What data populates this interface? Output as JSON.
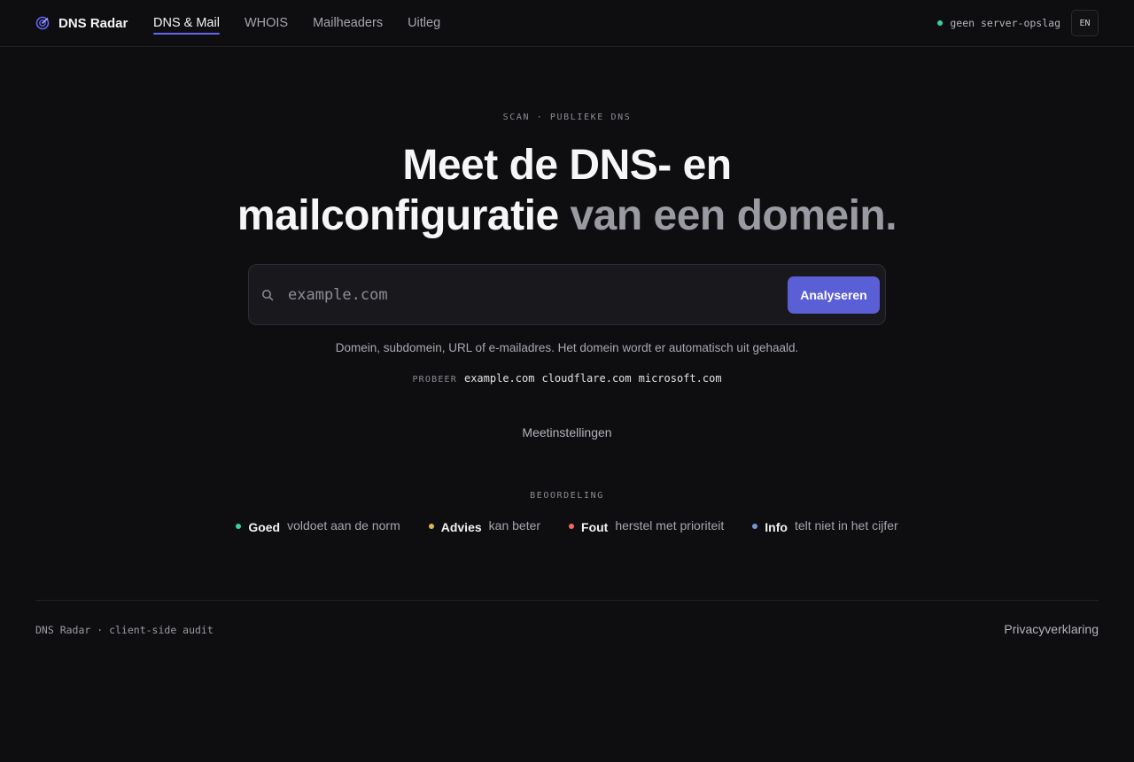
{
  "header": {
    "brand_name": "DNS Radar",
    "nav": [
      {
        "label": "DNS & Mail",
        "active": true
      },
      {
        "label": "WHOIS",
        "active": false
      },
      {
        "label": "Mailheaders",
        "active": false
      },
      {
        "label": "Uitleg",
        "active": false
      }
    ],
    "status_text": "geen server-opslag",
    "language_button": "EN"
  },
  "hero": {
    "eyebrow": "SCAN · PUBLIEKE DNS",
    "headline_line1": "Meet de DNS- en",
    "headline_line2_strong": "mailconfiguratie",
    "headline_line2_muted": "van een domein."
  },
  "search": {
    "placeholder": "example.com",
    "value": "",
    "button_label": "Analyseren",
    "hint": "Domein, subdomein, URL of e-mailadres. Het domein wordt er automatisch uit gehaald."
  },
  "try": {
    "label": "PROBEER",
    "examples": [
      "example.com",
      "cloudflare.com",
      "microsoft.com"
    ]
  },
  "settings_label": "Meetinstellingen",
  "legend": {
    "title": "BEOORDELING",
    "items": [
      {
        "name": "Goed",
        "desc": "voldoet aan de norm",
        "color": "#34d399"
      },
      {
        "name": "Advies",
        "desc": "kan beter",
        "color": "#e0b454"
      },
      {
        "name": "Fout",
        "desc": "herstel met prioriteit",
        "color": "#ef6b5b"
      },
      {
        "name": "Info",
        "desc": "telt niet in het cijfer",
        "color": "#7b93d6"
      }
    ]
  },
  "footer": {
    "left": "DNS Radar · client-side audit",
    "right": "Privacyverklaring"
  },
  "colors": {
    "accent": "#5b5fd6",
    "background": "#0e0e11"
  }
}
